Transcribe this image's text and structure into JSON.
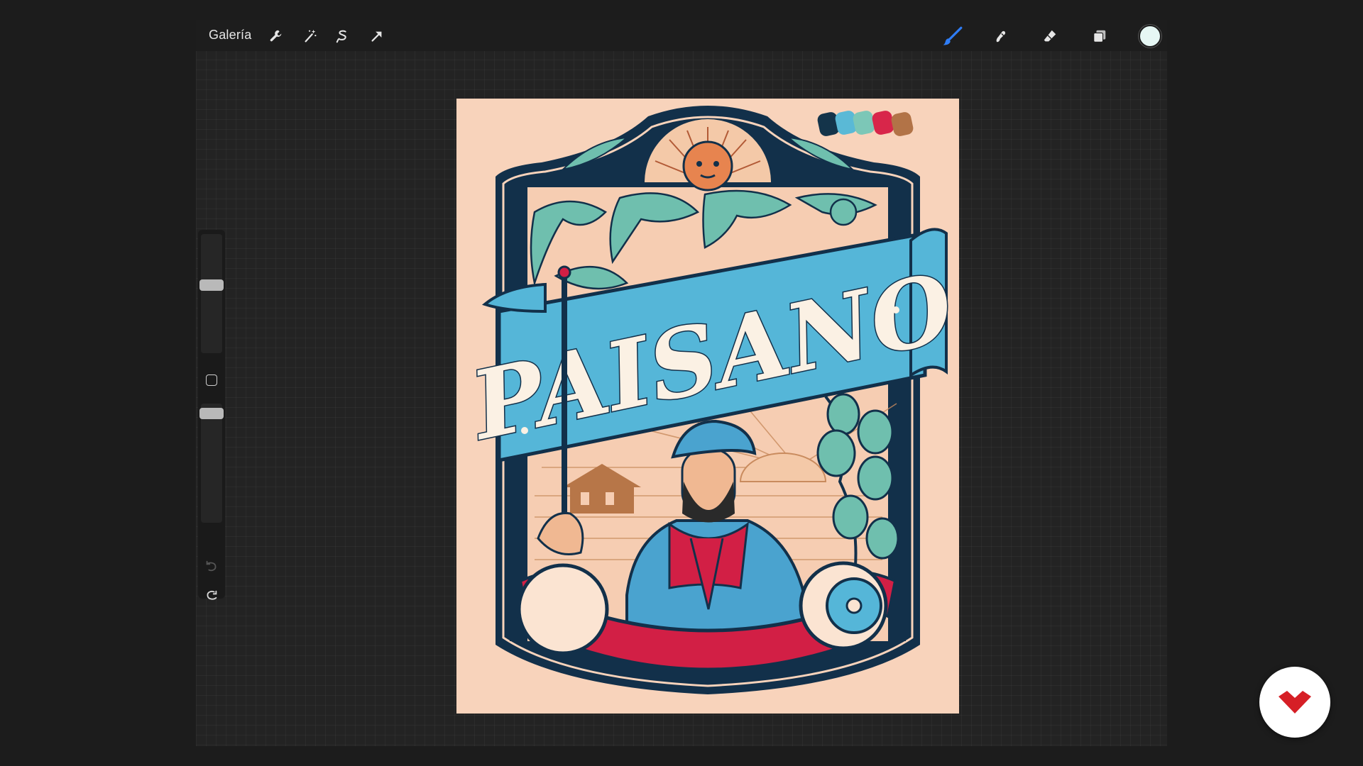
{
  "toolbar": {
    "gallery_label": "Galería",
    "left_tools": [
      "wrench-icon",
      "magic-wand-icon",
      "selection-icon",
      "transform-arrow-icon"
    ],
    "right_tools": [
      "brush-icon",
      "smudge-icon",
      "eraser-icon",
      "layers-icon"
    ],
    "active_tool": "brush-icon",
    "current_color": "#e6f7f4"
  },
  "sidebar": {
    "brush_size_level": 0.58,
    "opacity_level": 0.96
  },
  "artwork": {
    "title": "PAISANO",
    "palette": [
      "#14344a",
      "#5ab9d6",
      "#7cc7b7",
      "#d8264a",
      "#b27347"
    ],
    "colors": {
      "background": "#f8d3bb",
      "navy": "#12304a",
      "sky_blue": "#55b6d8",
      "teal": "#6fbfae",
      "red": "#d21f45",
      "cream": "#fbf1e4",
      "brown": "#b77648"
    }
  },
  "brand": {
    "logo_color": "#d61f26"
  }
}
